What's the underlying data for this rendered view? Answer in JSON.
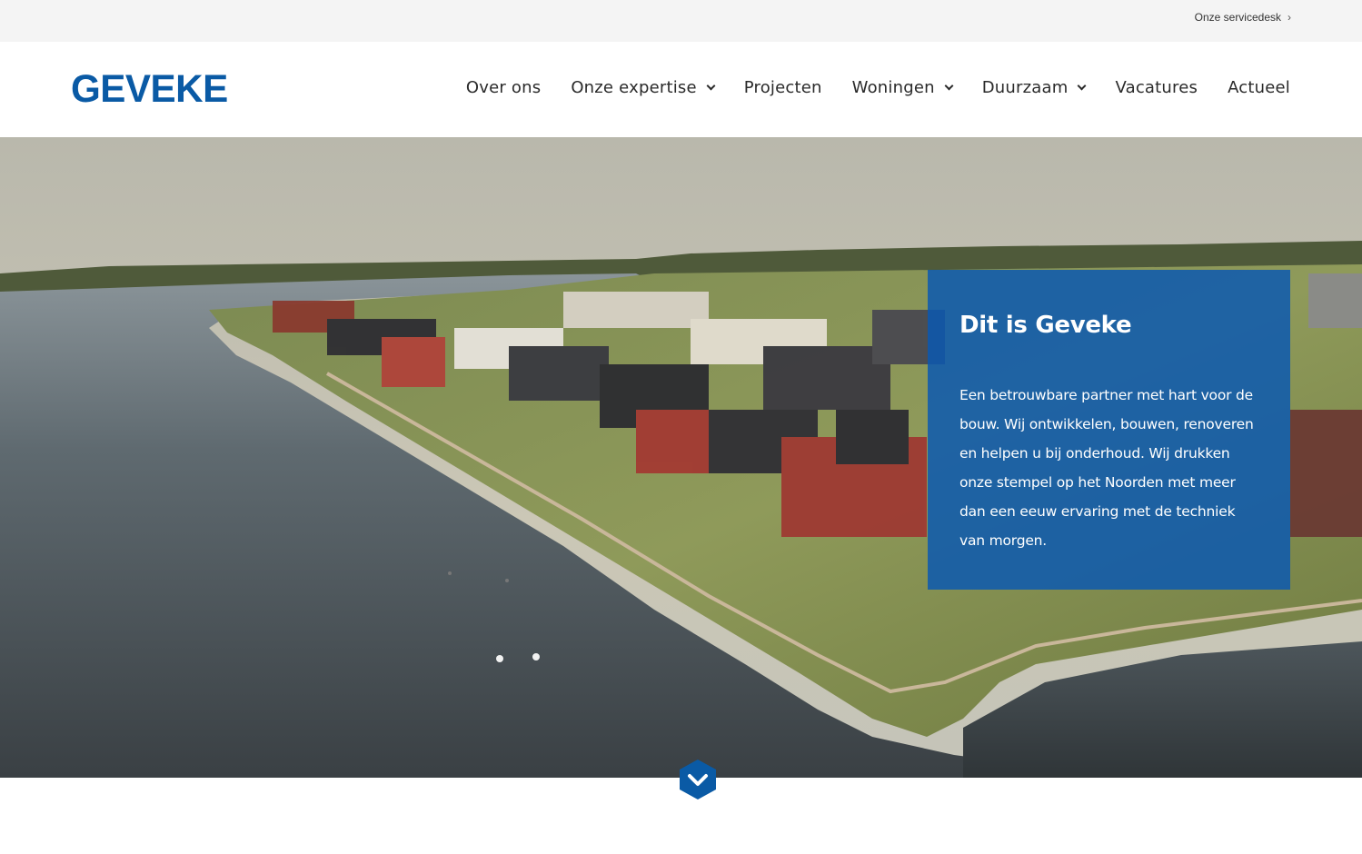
{
  "topbar": {
    "servicedesk_label": "Onze servicedesk",
    "servicedesk_icon": "chevron-right-icon"
  },
  "header": {
    "logo_text": "GEVEKE",
    "nav": [
      {
        "label": "Over ons",
        "has_dropdown": false
      },
      {
        "label": "Onze expertise",
        "has_dropdown": true
      },
      {
        "label": "Projecten",
        "has_dropdown": false
      },
      {
        "label": "Woningen",
        "has_dropdown": true
      },
      {
        "label": "Duurzaam",
        "has_dropdown": true
      },
      {
        "label": "Vacatures",
        "has_dropdown": false
      },
      {
        "label": "Actueel",
        "has_dropdown": false
      }
    ]
  },
  "hero": {
    "card_title": "Dit is Geveke",
    "card_text": "Een betrouwbare partner met hart voor de bouw. Wij ontwikkelen, bouwen, renoveren en helpen u bij onderhoud. Wij drukken onze stempel op het Noorden met meer dan een eeuw ervaring met de techniek van morgen.",
    "scroll_icon": "chevron-down-icon"
  },
  "colors": {
    "brand_blue": "#0a5aa5",
    "card_blue": "#0a58b2",
    "topbar_bg": "#f4f4f4"
  }
}
